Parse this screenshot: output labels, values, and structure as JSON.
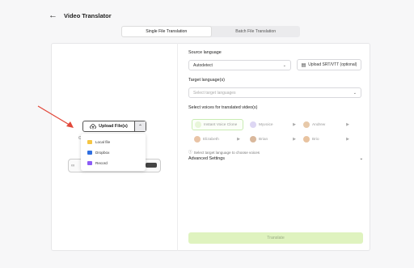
{
  "header": {
    "title": "Video Translator",
    "back_icon": "arrow-left-icon"
  },
  "tabs": [
    {
      "label": "Single File Translation",
      "active": true
    },
    {
      "label": "Batch File Translation",
      "active": false
    }
  ],
  "upload": {
    "button_label": "Upload File(s)",
    "menu": [
      {
        "label": "Local file",
        "icon": "folder-icon",
        "color": "#f5c542"
      },
      {
        "label": "Dropbox",
        "icon": "dropbox-icon",
        "color": "#2f6fe0"
      },
      {
        "label": "Record",
        "icon": "record-icon",
        "color": "#8b5cf6"
      }
    ]
  },
  "form": {
    "source_label": "Source language",
    "source_value": "Autodetect",
    "srt_label": "Upload SRT/VTT (optional)",
    "target_label": "Target language(s)",
    "target_placeholder": "Select target languages",
    "voices_label": "Select voices for translated video(s)",
    "voices": [
      {
        "name": "Instant Voice Clone",
        "selected": true,
        "color": "#e8f6d9"
      },
      {
        "name": "Myvoice",
        "selected": false,
        "color": "#ddd6f3"
      },
      {
        "name": "Andrew",
        "selected": false,
        "color": "#e7c9a9"
      },
      {
        "name": "Elizabeth",
        "selected": false,
        "color": "#e9c4a6"
      },
      {
        "name": "Brian",
        "selected": false,
        "color": "#d9b89c"
      },
      {
        "name": "Brio",
        "selected": false,
        "color": "#e8c3a0"
      }
    ],
    "hint": "Select target language to choose voices",
    "advanced_label": "Advanced Settings"
  },
  "actions": {
    "translate_label": "Translate"
  },
  "colors": {
    "accent": "#dff3bf",
    "accent_text": "#9aab85",
    "arrow": "#e2483a"
  }
}
